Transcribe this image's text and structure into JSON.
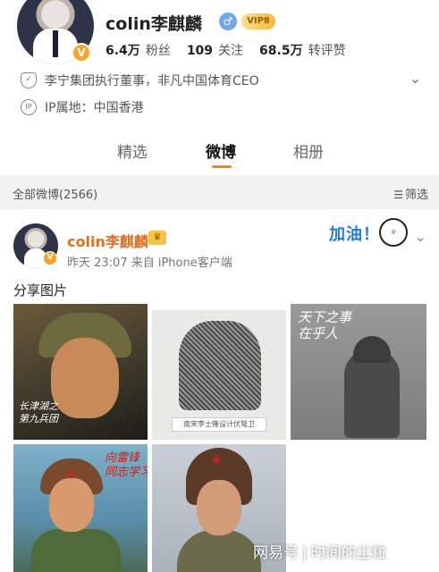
{
  "profile": {
    "username": "colin李麒麟",
    "vip_label": "VIP8",
    "verified_glyph": "V",
    "gender_glyph": "♂",
    "stats": [
      {
        "value": "6.4万",
        "label": "粉丝"
      },
      {
        "value": "109",
        "label": "关注"
      },
      {
        "value": "68.5万",
        "label": "转评赞"
      }
    ],
    "bio": "李宁集团执行董事，非凡中国体育CEO",
    "ip_location": "IP属地：中国香港",
    "ip_icon_text": "IP"
  },
  "tabs": [
    {
      "label": "精选",
      "active": false
    },
    {
      "label": "微博",
      "active": true
    },
    {
      "label": "相册",
      "active": false
    }
  ],
  "filter": {
    "count_label": "全部微博(2566)",
    "button_label": "筛选"
  },
  "post": {
    "username": "colin李麒麟",
    "meta": "昨天 23:07   来自 iPhone客户端",
    "text": "分享图片",
    "sticker_text": "加油！",
    "images": [
      {
        "calligraphy": "长津湖之\n第九兵团"
      },
      {
        "caption": "南宋李士雍设计伏弩卫"
      },
      {
        "calligraphy": "天下之事\n在乎人"
      },
      {
        "calligraphy": "向雷锋\n同志学习"
      },
      {}
    ]
  },
  "watermark": {
    "brand": "网易号",
    "separator": "|",
    "account": "时间的尘粒"
  },
  "colors": {
    "accent_orange": "#ff8200",
    "post_username": "#e86c1a",
    "verified_badge": "#f5a623",
    "filter_bar_bg": "#f2f2f2"
  }
}
